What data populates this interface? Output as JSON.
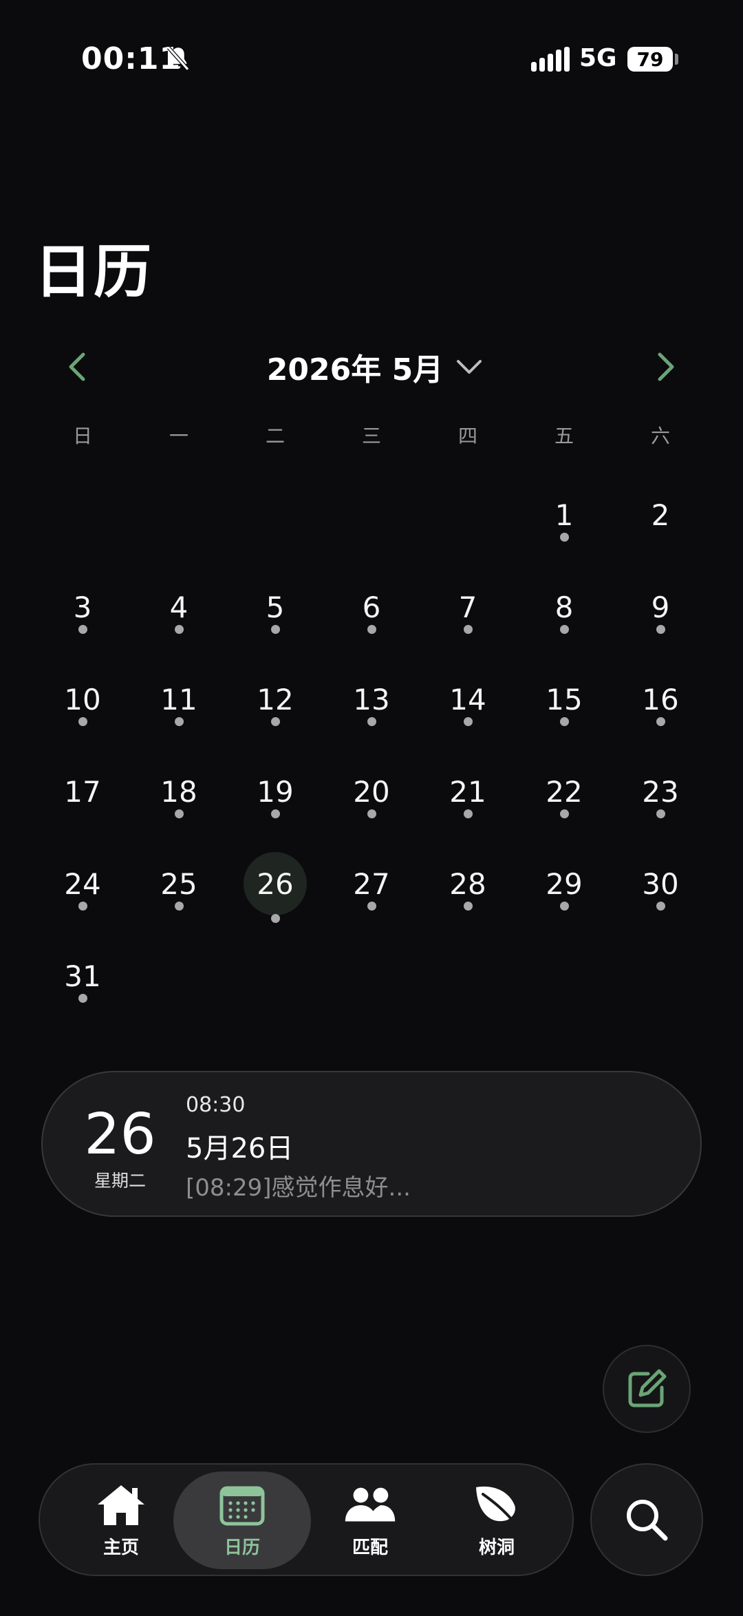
{
  "status_bar": {
    "time": "00:11",
    "network": "5G",
    "battery": "79"
  },
  "page_title": "日历",
  "month_header": {
    "label": "2026年 5月"
  },
  "weekdays": [
    "日",
    "一",
    "二",
    "三",
    "四",
    "五",
    "六"
  ],
  "days": [
    {
      "n": ""
    },
    {
      "n": ""
    },
    {
      "n": ""
    },
    {
      "n": ""
    },
    {
      "n": ""
    },
    {
      "n": "1",
      "dot": true
    },
    {
      "n": "2",
      "dot": false
    },
    {
      "n": "3",
      "dot": true
    },
    {
      "n": "4",
      "dot": true
    },
    {
      "n": "5",
      "dot": true
    },
    {
      "n": "6",
      "dot": true
    },
    {
      "n": "7",
      "dot": true
    },
    {
      "n": "8",
      "dot": true
    },
    {
      "n": "9",
      "dot": true
    },
    {
      "n": "10",
      "dot": true
    },
    {
      "n": "11",
      "dot": true
    },
    {
      "n": "12",
      "dot": true
    },
    {
      "n": "13",
      "dot": true
    },
    {
      "n": "14",
      "dot": true
    },
    {
      "n": "15",
      "dot": true
    },
    {
      "n": "16",
      "dot": true
    },
    {
      "n": "17",
      "dot": false
    },
    {
      "n": "18",
      "dot": true
    },
    {
      "n": "19",
      "dot": true
    },
    {
      "n": "20",
      "dot": true
    },
    {
      "n": "21",
      "dot": true
    },
    {
      "n": "22",
      "dot": true
    },
    {
      "n": "23",
      "dot": true
    },
    {
      "n": "24",
      "dot": true
    },
    {
      "n": "25",
      "dot": true
    },
    {
      "n": "26",
      "dot": true,
      "selected": true
    },
    {
      "n": "27",
      "dot": true
    },
    {
      "n": "28",
      "dot": true
    },
    {
      "n": "29",
      "dot": true
    },
    {
      "n": "30",
      "dot": true
    },
    {
      "n": "31",
      "dot": true
    }
  ],
  "entry": {
    "day": "26",
    "weekday": "星期二",
    "time": "08:30",
    "title": "5月26日",
    "preview": "[08:29]感觉作息好..."
  },
  "tabs": [
    {
      "label": "主页",
      "icon": "home-icon"
    },
    {
      "label": "日历",
      "icon": "calendar-icon"
    },
    {
      "label": "匹配",
      "icon": "people-icon"
    },
    {
      "label": "树洞",
      "icon": "leaf-icon"
    }
  ],
  "colors": {
    "accent": "#6aa577",
    "active_tab_label": "#8ec49a",
    "background": "#0b0b0d"
  }
}
